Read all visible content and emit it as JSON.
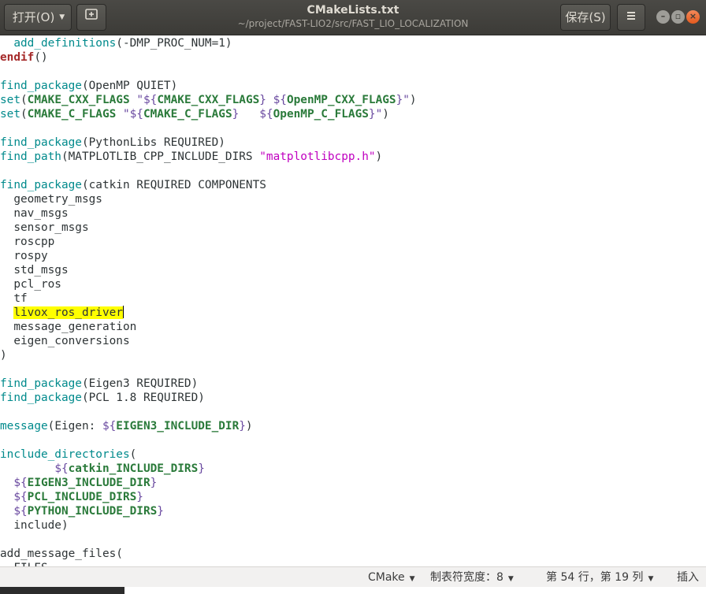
{
  "header": {
    "open_label": "打开(O)",
    "save_label": "保存(S)",
    "title": "CMakeLists.txt",
    "subtitle": "~/project/FAST-LIO2/src/FAST_LIO_LOCALIZATION",
    "icons": [
      "new-tab-icon",
      "hamburger-menu-icon",
      "minimize-icon",
      "maximize-icon",
      "close-icon"
    ]
  },
  "editor": {
    "lines": [
      [
        {
          "t": "  "
        },
        {
          "t": "add_definitions",
          "c": "fn"
        },
        {
          "t": "(-DMP_PROC_NUM=1)"
        }
      ],
      [
        {
          "t": "endif",
          "c": "kw"
        },
        {
          "t": "()"
        }
      ],
      [],
      [
        {
          "t": "find_package",
          "c": "fn"
        },
        {
          "t": "(OpenMP QUIET)"
        }
      ],
      [
        {
          "t": "set",
          "c": "fn"
        },
        {
          "t": "("
        },
        {
          "t": "CMAKE_CXX_FLAGS",
          "c": "varname"
        },
        {
          "t": " "
        },
        {
          "t": "\"${",
          "c": "var"
        },
        {
          "t": "CMAKE_CXX_FLAGS",
          "c": "varname"
        },
        {
          "t": "}",
          "c": "var"
        },
        {
          "t": " "
        },
        {
          "t": "${",
          "c": "var"
        },
        {
          "t": "OpenMP_CXX_FLAGS",
          "c": "varname"
        },
        {
          "t": "}\"",
          "c": "var"
        },
        {
          "t": ")"
        }
      ],
      [
        {
          "t": "set",
          "c": "fn"
        },
        {
          "t": "("
        },
        {
          "t": "CMAKE_C_FLAGS",
          "c": "varname"
        },
        {
          "t": " "
        },
        {
          "t": "\"${",
          "c": "var"
        },
        {
          "t": "CMAKE_C_FLAGS",
          "c": "varname"
        },
        {
          "t": "}",
          "c": "var"
        },
        {
          "t": "   "
        },
        {
          "t": "${",
          "c": "var"
        },
        {
          "t": "OpenMP_C_FLAGS",
          "c": "varname"
        },
        {
          "t": "}\"",
          "c": "var"
        },
        {
          "t": ")"
        }
      ],
      [],
      [
        {
          "t": "find_package",
          "c": "fn"
        },
        {
          "t": "(PythonLibs REQUIRED)"
        }
      ],
      [
        {
          "t": "find_path",
          "c": "fn"
        },
        {
          "t": "(MATPLOTLIB_CPP_INCLUDE_DIRS "
        },
        {
          "t": "\"matplotlibcpp.h\"",
          "c": "str"
        },
        {
          "t": ")"
        }
      ],
      [],
      [
        {
          "t": "find_package",
          "c": "fn"
        },
        {
          "t": "(catkin REQUIRED COMPONENTS"
        }
      ],
      [
        {
          "t": "  geometry_msgs"
        }
      ],
      [
        {
          "t": "  nav_msgs"
        }
      ],
      [
        {
          "t": "  sensor_msgs"
        }
      ],
      [
        {
          "t": "  roscpp"
        }
      ],
      [
        {
          "t": "  rospy"
        }
      ],
      [
        {
          "t": "  std_msgs"
        }
      ],
      [
        {
          "t": "  pcl_ros"
        }
      ],
      [
        {
          "t": "  tf"
        }
      ],
      [
        {
          "t": "  "
        },
        {
          "t": "livox_ros_driver",
          "c": "hl",
          "caret": true
        }
      ],
      [
        {
          "t": "  message_generation"
        }
      ],
      [
        {
          "t": "  eigen_conversions"
        }
      ],
      [
        {
          "t": ")"
        }
      ],
      [],
      [
        {
          "t": "find_package",
          "c": "fn"
        },
        {
          "t": "(Eigen3 REQUIRED)"
        }
      ],
      [
        {
          "t": "find_package",
          "c": "fn"
        },
        {
          "t": "(PCL 1.8 REQUIRED)"
        }
      ],
      [],
      [
        {
          "t": "message",
          "c": "fn"
        },
        {
          "t": "(Eigen: "
        },
        {
          "t": "${",
          "c": "var"
        },
        {
          "t": "EIGEN3_INCLUDE_DIR",
          "c": "varname"
        },
        {
          "t": "}",
          "c": "var"
        },
        {
          "t": ")"
        }
      ],
      [],
      [
        {
          "t": "include_directories",
          "c": "fn"
        },
        {
          "t": "("
        }
      ],
      [
        {
          "t": "        "
        },
        {
          "t": "${",
          "c": "var"
        },
        {
          "t": "catkin_INCLUDE_DIRS",
          "c": "varname"
        },
        {
          "t": "}",
          "c": "var"
        }
      ],
      [
        {
          "t": "  "
        },
        {
          "t": "${",
          "c": "var"
        },
        {
          "t": "EIGEN3_INCLUDE_DIR",
          "c": "varname"
        },
        {
          "t": "}",
          "c": "var"
        }
      ],
      [
        {
          "t": "  "
        },
        {
          "t": "${",
          "c": "var"
        },
        {
          "t": "PCL_INCLUDE_DIRS",
          "c": "varname"
        },
        {
          "t": "}",
          "c": "var"
        }
      ],
      [
        {
          "t": "  "
        },
        {
          "t": "${",
          "c": "var"
        },
        {
          "t": "PYTHON_INCLUDE_DIRS",
          "c": "varname"
        },
        {
          "t": "}",
          "c": "var"
        }
      ],
      [
        {
          "t": "  include)"
        }
      ],
      [],
      [
        {
          "t": "add_message_files("
        }
      ],
      [
        {
          "t": "  FILES"
        }
      ]
    ]
  },
  "statusbar": {
    "language": "CMake",
    "tab_width": "制表符宽度：8",
    "position": "第 54 行，第 19 列",
    "mode": "插入"
  }
}
